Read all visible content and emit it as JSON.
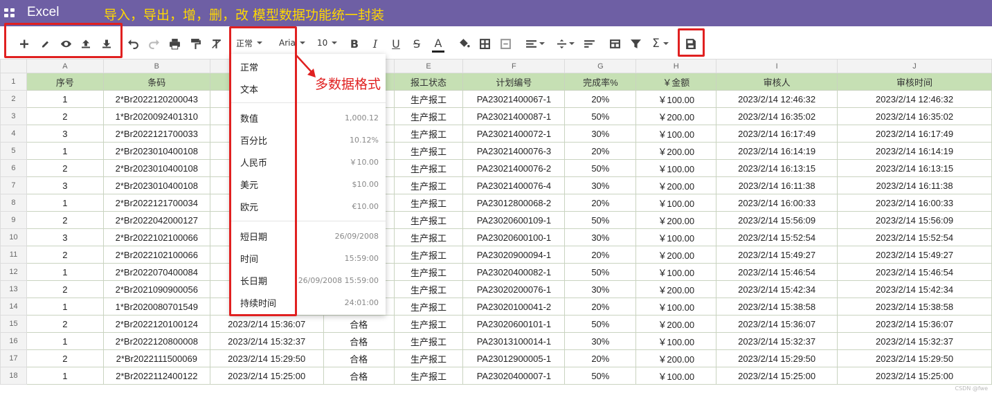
{
  "titlebar": {
    "app": "Excel",
    "annotation": "导入，导出，增，删，改 模型数据功能统一封装",
    "color": "#6e5fa4",
    "annotation_color": "#ffd800"
  },
  "toolbar": {
    "number_format": "正常",
    "font_name": "Aria",
    "font_size": "10",
    "icons": [
      "plus-icon",
      "pencil-icon",
      "eye-icon",
      "upload-icon",
      "download-icon",
      "undo-icon",
      "redo-icon",
      "print-icon",
      "paint-format-icon",
      "clear-format-icon",
      "bold-icon",
      "italic-icon",
      "underline-icon",
      "strikethrough-icon",
      "text-color-icon",
      "fill-color-icon",
      "borders-icon",
      "merge-cells-icon",
      "align-horizontal-icon",
      "align-vertical-icon",
      "text-wrap-icon",
      "freeze-icon",
      "filter-icon",
      "sum-icon",
      "save-icon"
    ],
    "bold": "B",
    "italic": "I",
    "underline": "U",
    "strike": "S",
    "textcolor": "A",
    "sum": "Σ"
  },
  "format_menu": {
    "items": [
      {
        "label": "正常",
        "example": ""
      },
      {
        "label": "文本",
        "example": ""
      },
      {
        "label": "数值",
        "example": "1,000.12"
      },
      {
        "label": "百分比",
        "example": "10.12%"
      },
      {
        "label": "人民币",
        "example": "￥10.00"
      },
      {
        "label": "美元",
        "example": "$10.00"
      },
      {
        "label": "欧元",
        "example": "€10.00"
      },
      {
        "label": "短日期",
        "example": "26/09/2008"
      },
      {
        "label": "时间",
        "example": "15:59:00"
      },
      {
        "label": "长日期",
        "example": "26/09/2008 15:59:00"
      },
      {
        "label": "持续时间",
        "example": "24:01:00"
      }
    ]
  },
  "callout": "多数据格式",
  "accent": "#e02020",
  "header_fill": "#c6e0b4",
  "watermark": "CSDN @fwe",
  "columns": [
    "A",
    "B",
    "C",
    "D",
    "E",
    "F",
    "G",
    "H",
    "I",
    "J"
  ],
  "header_row": [
    "序号",
    "条码",
    "",
    "",
    "报工状态",
    "计划编号",
    "完成率%",
    "￥金额",
    "审核人",
    "审核时间"
  ],
  "rows": [
    [
      "1",
      "2*Br2022120200043",
      "",
      "",
      "生产报工",
      "PA23021400067-1",
      "20%",
      "￥100.00",
      "2023/2/14 12:46:32",
      "2023/2/14 12:46:32"
    ],
    [
      "2",
      "1*Br2020092401310",
      "",
      "",
      "生产报工",
      "PA23021400087-1",
      "50%",
      "￥200.00",
      "2023/2/14 16:35:02",
      "2023/2/14 16:35:02"
    ],
    [
      "3",
      "2*Br2022121700033",
      "",
      "",
      "生产报工",
      "PA23021400072-1",
      "30%",
      "￥100.00",
      "2023/2/14 16:17:49",
      "2023/2/14 16:17:49"
    ],
    [
      "1",
      "2*Br2023010400108",
      "",
      "",
      "生产报工",
      "PA23021400076-3",
      "20%",
      "￥200.00",
      "2023/2/14 16:14:19",
      "2023/2/14 16:14:19"
    ],
    [
      "2",
      "2*Br2023010400108",
      "",
      "",
      "生产报工",
      "PA23021400076-2",
      "50%",
      "￥100.00",
      "2023/2/14 16:13:15",
      "2023/2/14 16:13:15"
    ],
    [
      "3",
      "2*Br2023010400108",
      "",
      "",
      "生产报工",
      "PA23021400076-4",
      "30%",
      "￥200.00",
      "2023/2/14 16:11:38",
      "2023/2/14 16:11:38"
    ],
    [
      "1",
      "2*Br2022121700034",
      "",
      "",
      "生产报工",
      "PA23012800068-2",
      "20%",
      "￥100.00",
      "2023/2/14 16:00:33",
      "2023/2/14 16:00:33"
    ],
    [
      "2",
      "2*Br2022042000127",
      "",
      "",
      "生产报工",
      "PA23020600109-1",
      "50%",
      "￥200.00",
      "2023/2/14 15:56:09",
      "2023/2/14 15:56:09"
    ],
    [
      "3",
      "2*Br2022102100066",
      "",
      "",
      "生产报工",
      "PA23020600100-1",
      "30%",
      "￥100.00",
      "2023/2/14 15:52:54",
      "2023/2/14 15:52:54"
    ],
    [
      "2",
      "2*Br2022102100066",
      "",
      "",
      "生产报工",
      "PA23020900094-1",
      "20%",
      "￥200.00",
      "2023/2/14 15:49:27",
      "2023/2/14 15:49:27"
    ],
    [
      "1",
      "2*Br2022070400084",
      "",
      "",
      "生产报工",
      "PA23020400082-1",
      "50%",
      "￥100.00",
      "2023/2/14 15:46:54",
      "2023/2/14 15:46:54"
    ],
    [
      "2",
      "2*Br2021090900056",
      "",
      "",
      "生产报工",
      "PA23020200076-1",
      "30%",
      "￥200.00",
      "2023/2/14 15:42:34",
      "2023/2/14 15:42:34"
    ],
    [
      "1",
      "1*Br2020080701549",
      "",
      "",
      "生产报工",
      "PA23020100041-2",
      "20%",
      "￥100.00",
      "2023/2/14 15:38:58",
      "2023/2/14 15:38:58"
    ],
    [
      "2",
      "2*Br2022120100124",
      "2023/2/14 15:36:07",
      "合格",
      "生产报工",
      "PA23020600101-1",
      "50%",
      "￥200.00",
      "2023/2/14 15:36:07",
      "2023/2/14 15:36:07"
    ],
    [
      "1",
      "2*Br2022120800008",
      "2023/2/14 15:32:37",
      "合格",
      "生产报工",
      "PA23013100014-1",
      "30%",
      "￥100.00",
      "2023/2/14 15:32:37",
      "2023/2/14 15:32:37"
    ],
    [
      "2",
      "2*Br2022111500069",
      "2023/2/14 15:29:50",
      "合格",
      "生产报工",
      "PA23012900005-1",
      "20%",
      "￥200.00",
      "2023/2/14 15:29:50",
      "2023/2/14 15:29:50"
    ],
    [
      "1",
      "2*Br2022112400122",
      "2023/2/14 15:25:00",
      "合格",
      "生产报工",
      "PA23020400007-1",
      "50%",
      "￥100.00",
      "2023/2/14 15:25:00",
      "2023/2/14 15:25:00"
    ]
  ]
}
